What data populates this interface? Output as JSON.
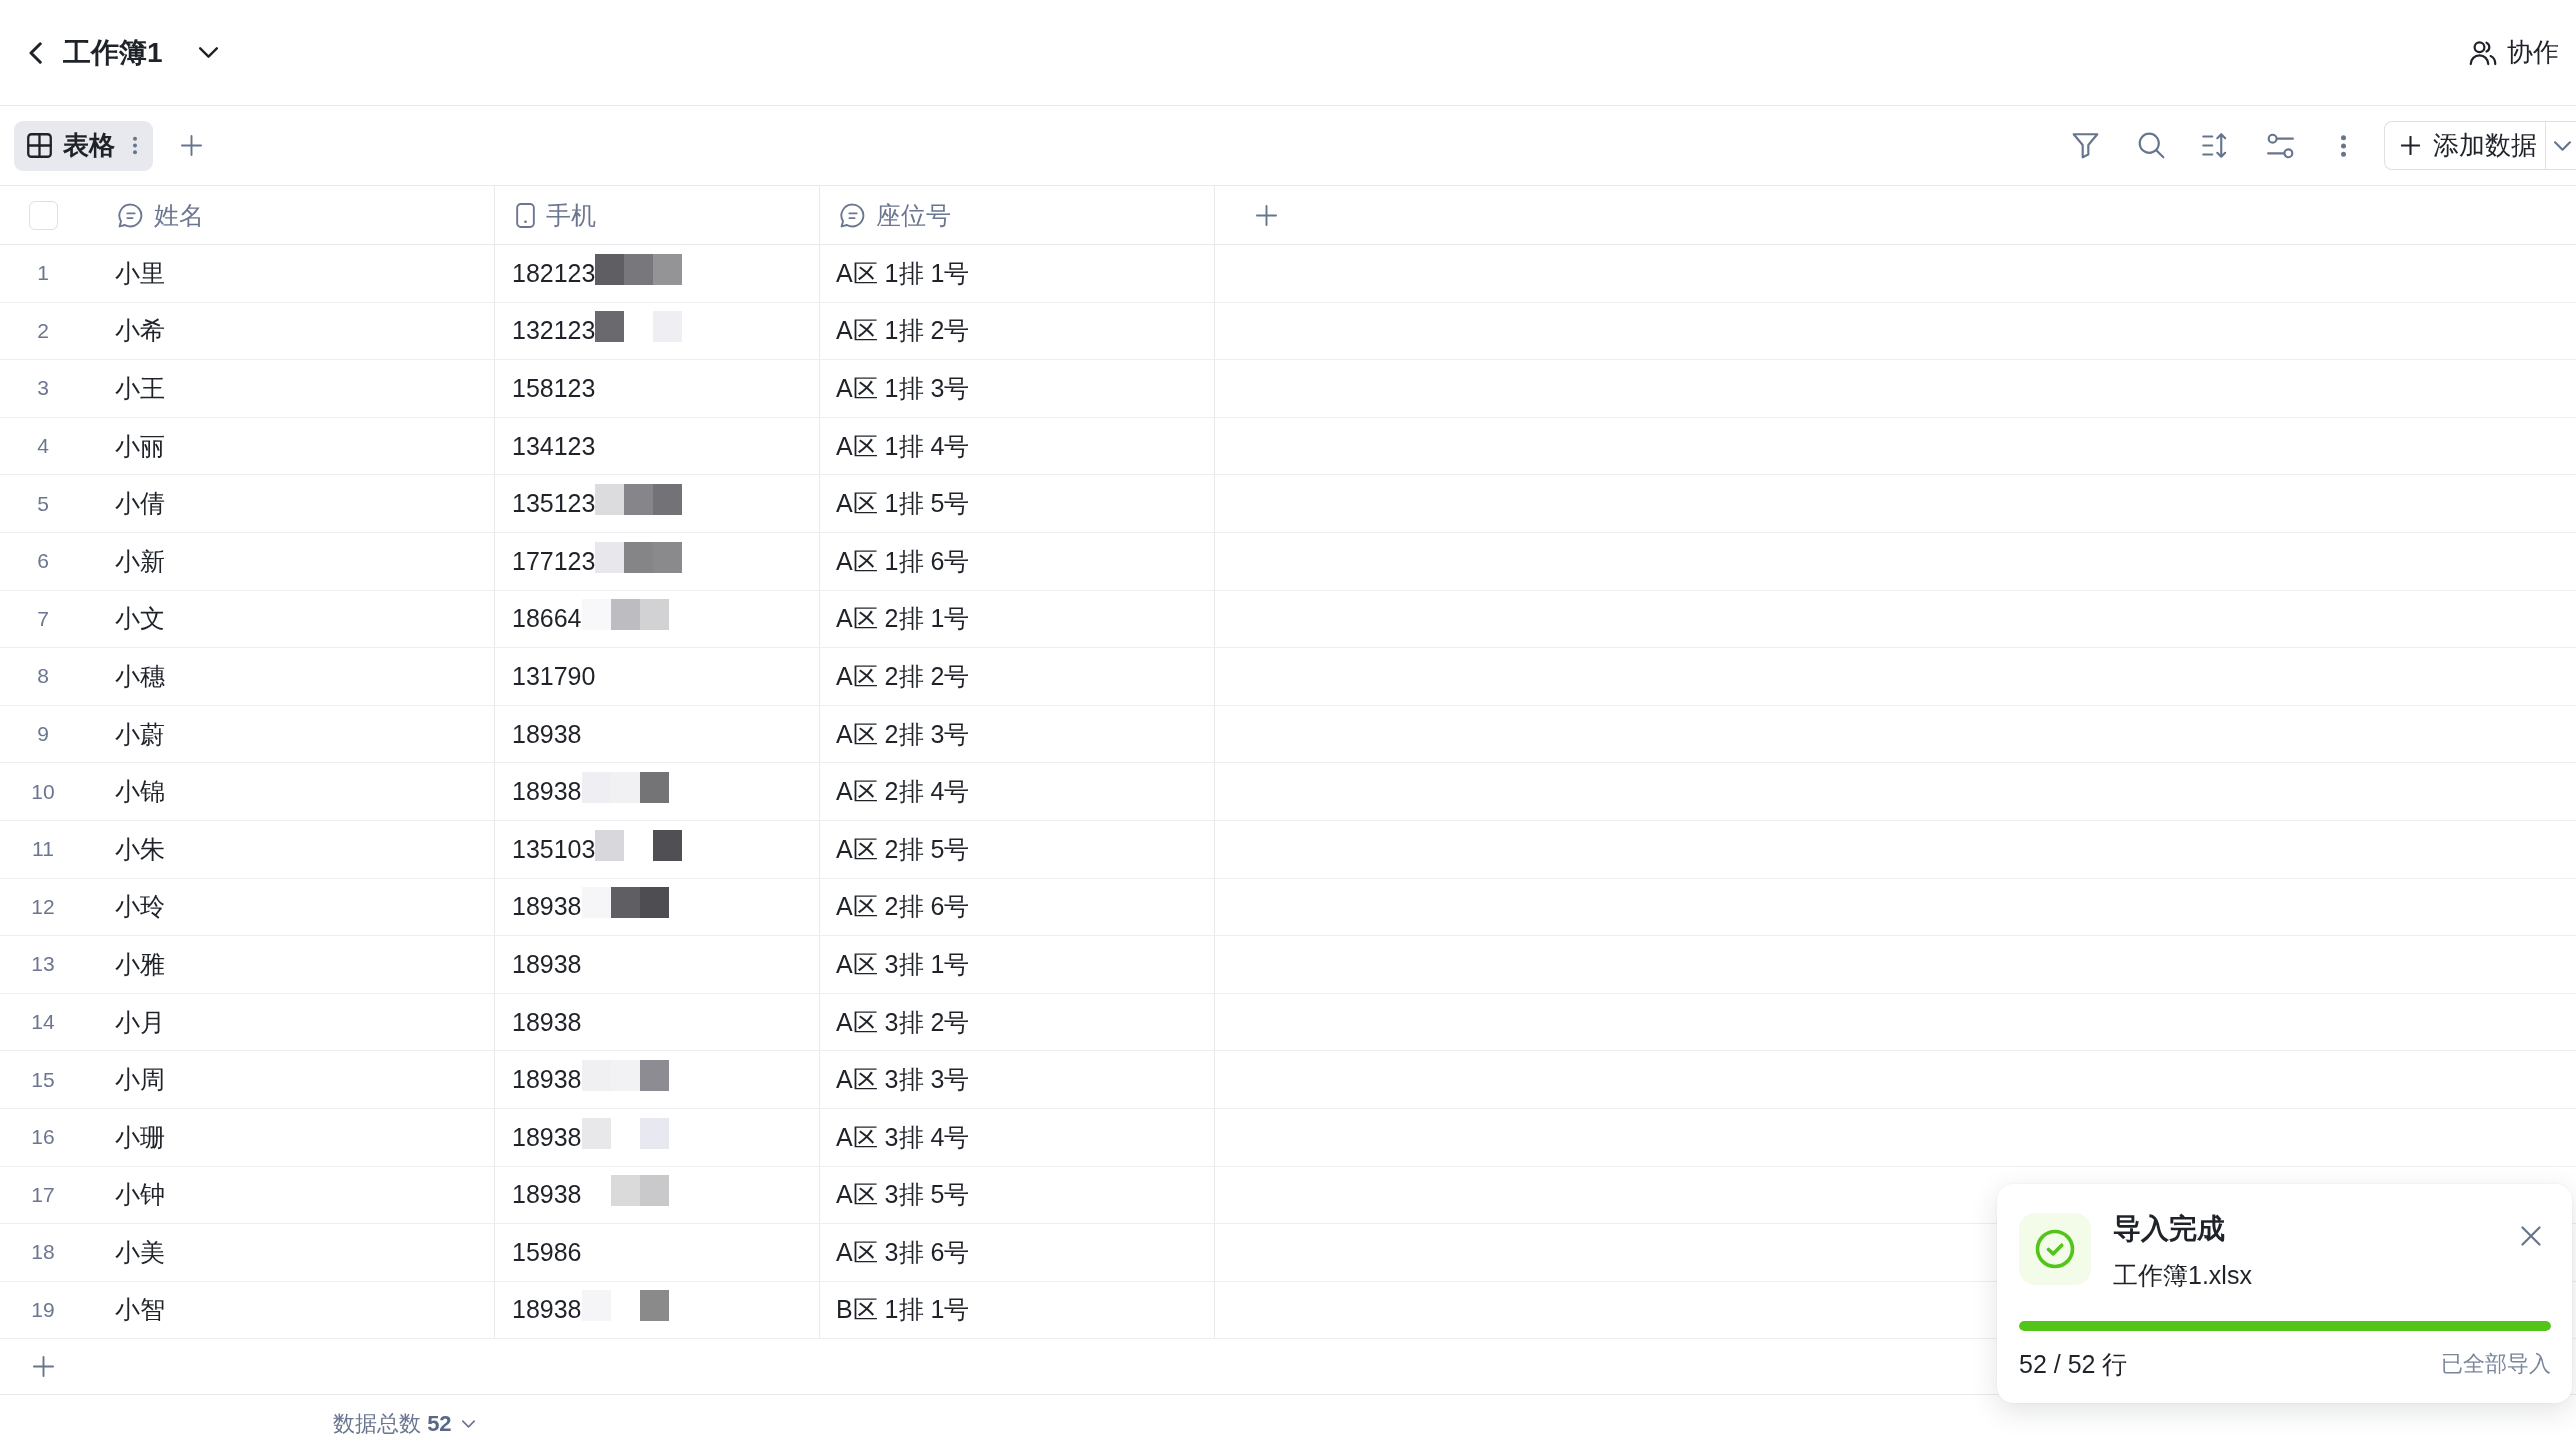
{
  "header": {
    "title": "工作簿1",
    "collaborate": "协作"
  },
  "views": {
    "tabs": [
      {
        "label": "表格",
        "selected": true
      }
    ]
  },
  "toolbar": {
    "add_button": "添加数据"
  },
  "table": {
    "select_all": {
      "checked": false
    },
    "columns": [
      {
        "label": "姓名",
        "kind": "text"
      },
      {
        "label": "手机",
        "kind": "phone"
      },
      {
        "label": "座位号",
        "kind": "text"
      }
    ],
    "rows": [
      {
        "number": "1",
        "cells": [
          "小里",
          "182123",
          "A区 1排 1号"
        ]
      },
      {
        "number": "2",
        "cells": [
          "小希",
          "132123",
          "A区 1排 2号"
        ]
      },
      {
        "number": "3",
        "cells": [
          "小王",
          "158123",
          "A区 1排 3号"
        ]
      },
      {
        "number": "4",
        "cells": [
          "小丽",
          "134123",
          "A区 1排 4号"
        ]
      },
      {
        "number": "5",
        "cells": [
          "小倩",
          "135123",
          "A区 1排 5号"
        ]
      },
      {
        "number": "6",
        "cells": [
          "小新",
          "177123",
          "A区 1排 6号"
        ]
      },
      {
        "number": "7",
        "cells": [
          "小文",
          "18664",
          "A区 2排 1号"
        ]
      },
      {
        "number": "8",
        "cells": [
          "小穗",
          "131790",
          "A区 2排 2号"
        ]
      },
      {
        "number": "9",
        "cells": [
          "小蔚",
          "18938",
          "A区 2排 3号"
        ]
      },
      {
        "number": "10",
        "cells": [
          "小锦",
          "18938",
          "A区 2排 4号"
        ]
      },
      {
        "number": "11",
        "cells": [
          "小朱",
          "135103",
          "A区 2排 5号"
        ]
      },
      {
        "number": "12",
        "cells": [
          "小玲",
          "18938",
          "A区 2排 6号"
        ]
      },
      {
        "number": "13",
        "cells": [
          "小雅",
          "18938",
          "A区 3排 1号"
        ]
      },
      {
        "number": "14",
        "cells": [
          "小月",
          "18938",
          "A区 3排 2号"
        ]
      },
      {
        "number": "15",
        "cells": [
          "小周",
          "18938",
          "A区 3排 3号"
        ]
      },
      {
        "number": "16",
        "cells": [
          "小珊",
          "18938",
          "A区 3排 4号"
        ]
      },
      {
        "number": "17",
        "cells": [
          "小钟",
          "18938",
          "A区 3排 5号"
        ]
      },
      {
        "number": "18",
        "cells": [
          "小美",
          "15986",
          "A区 3排 6号"
        ]
      },
      {
        "number": "19",
        "cells": [
          "小智",
          "18938",
          "B区 1排 1号"
        ]
      }
    ]
  },
  "footer": {
    "summary": "数据总数 **52**"
  },
  "toast": {
    "title": "导入完成",
    "file": "工作簿1.xlsx",
    "level": 1,
    "count": "52 / 52 行",
    "status": "已全部导入"
  }
}
